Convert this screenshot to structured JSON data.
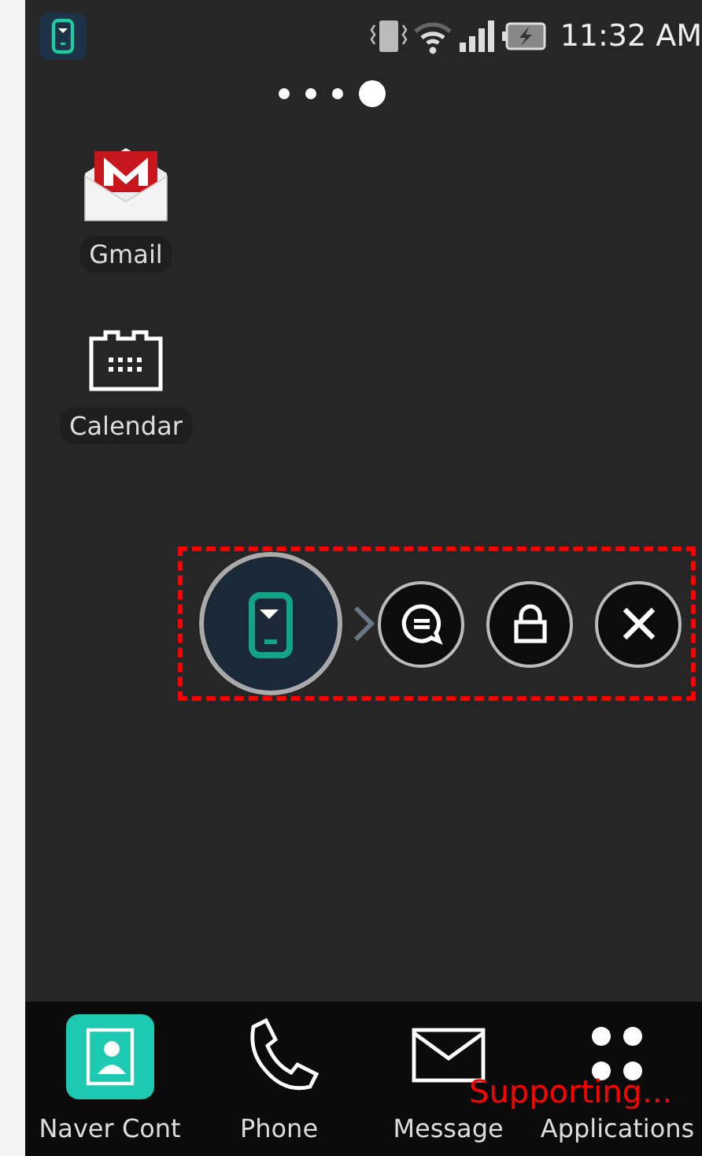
{
  "status_bar": {
    "time": "11:32 AM",
    "battery_charging": true
  },
  "pages": [
    {
      "selected": false
    },
    {
      "selected": false
    },
    {
      "selected": false
    },
    {
      "selected": true
    }
  ],
  "desktop_items": [
    {
      "kind": "mail",
      "label": "Gmail"
    },
    {
      "kind": "calendar",
      "label": "Calendar"
    }
  ],
  "floating_bar": {
    "actions": [
      {
        "kind": "chat"
      },
      {
        "kind": "lock"
      },
      {
        "kind": "close"
      }
    ]
  },
  "dock": [
    {
      "kind": "contacts",
      "label": "Naver Cont"
    },
    {
      "kind": "phone",
      "label": "Phone"
    },
    {
      "kind": "message",
      "label": "Message"
    },
    {
      "kind": "apps",
      "label": "Applications"
    }
  ],
  "overlay_text": "Supporting..."
}
